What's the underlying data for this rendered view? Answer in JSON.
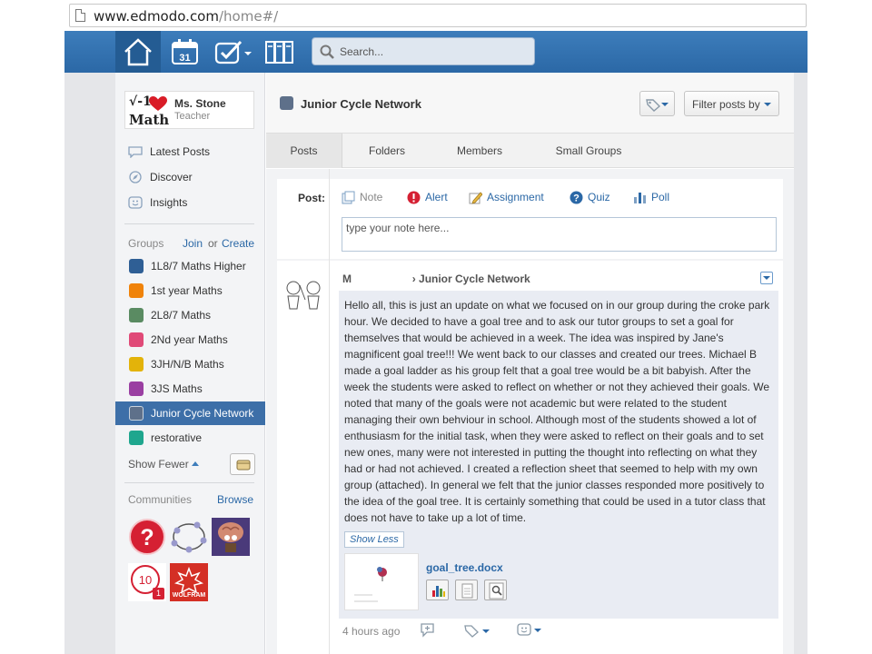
{
  "browser": {
    "url_domain": "www.edmodo.com",
    "url_path": "/home#/"
  },
  "search": {
    "placeholder": "Search..."
  },
  "profile": {
    "logo_top": "√-1",
    "logo_bottom": "Math",
    "name": "Ms. Stone",
    "role": "Teacher"
  },
  "nav": {
    "latest_posts": "Latest Posts",
    "discover": "Discover",
    "insights": "Insights",
    "calendar_day": "31"
  },
  "groups": {
    "header": "Groups",
    "join": "Join",
    "or": "or",
    "create": "Create",
    "items": [
      {
        "label": "1L8/7 Maths Higher",
        "color": "#2f5f95"
      },
      {
        "label": "1st year Maths",
        "color": "#f0830a"
      },
      {
        "label": "2L8/7 Maths",
        "color": "#5a8b62"
      },
      {
        "label": "2Nd year Maths",
        "color": "#e04a78"
      },
      {
        "label": "3JH/N/B Maths",
        "color": "#e3b30a"
      },
      {
        "label": "3JS Maths",
        "color": "#9a3fa2"
      },
      {
        "label": "Junior Cycle Network",
        "color": "#5e708a"
      },
      {
        "label": "restorative",
        "color": "#1fa68e"
      }
    ],
    "show_fewer": "Show Fewer"
  },
  "communities": {
    "header": "Communities",
    "browse": "Browse",
    "badge_count": "1",
    "wolfram_label": "WOLFRAM"
  },
  "main": {
    "group_title": "Junior Cycle Network",
    "filter_label": "Filter posts by",
    "tabs": [
      "Posts",
      "Folders",
      "Members",
      "Small Groups"
    ],
    "composer": {
      "label": "Post:",
      "types": [
        "Note",
        "Alert",
        "Assignment",
        "Quiz",
        "Poll"
      ],
      "note_placeholder": "type your note here..."
    },
    "post": {
      "author": "M",
      "recipient": "› Junior Cycle Network",
      "body": "Hello all, this is just an update on what we focused on in our group during the croke park hour. We decided to have a goal tree and to ask our tutor groups to set a goal for themselves that would be achieved in a week. The idea was inspired by Jane's magnificent goal tree!!! We went back to our classes and created our trees. Michael B made a goal ladder as his group felt that a goal tree would be a bit babyish. After the week the students were asked to reflect on whether or not they achieved their goals. We noted that many of the goals were not academic but were related to the student managing their own behviour in school. Although most of the students showed a lot of enthusiasm for the initial task, when they were asked to reflect on their goals and to set new ones, many were not interested in putting the thought into reflecting on what they had or had not achieved. I created a reflection sheet that seemed to help with my own group (attached). In general we felt that the junior classes responded more positively to the idea of the goal tree. It is certainly something that could be used in a tutor class that does not have to take up a lot of time.",
      "show_less": "Show Less",
      "attachment_name": "goal_tree.docx",
      "timestamp": "4 hours ago"
    }
  },
  "colors": {
    "nav_blue": "#2b68a6",
    "active_group": "#3d6fa8",
    "link_blue": "#2b68a6"
  }
}
